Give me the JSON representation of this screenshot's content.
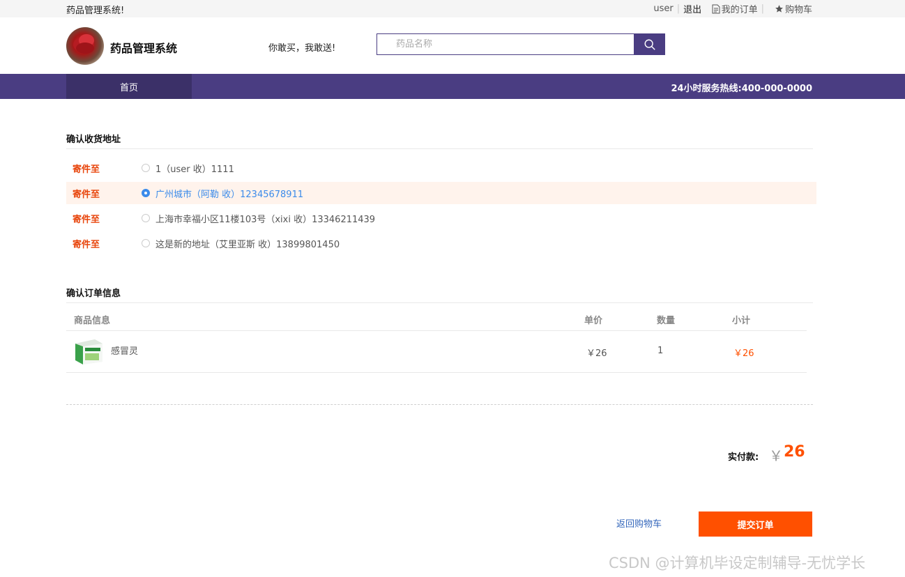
{
  "topbar": {
    "site_name": "药品管理系统!",
    "username": "user",
    "logout": "退出",
    "orders": "我的订单",
    "cart": "购物车",
    "orders_icon": "document-icon",
    "cart_icon": "star-icon"
  },
  "header": {
    "title": "药品管理系统",
    "slogan": "你敢买，我敢送!",
    "search_placeholder": "药品名称",
    "search_icon": "search-icon"
  },
  "nav": {
    "home": "首页",
    "hotline": "24小时服务热线:400-000-0000"
  },
  "address_section": {
    "title": "确认收货地址",
    "tag": "寄件至",
    "addresses": [
      {
        "text": "1（user 收）1111",
        "selected": false
      },
      {
        "text": "广州城市（阿勒 收）12345678911",
        "selected": true
      },
      {
        "text": "上海市幸福小区11楼103号（xixi 收）13346211439",
        "selected": false
      },
      {
        "text": "这是新的地址（艾里亚斯 收）13899801450",
        "selected": false
      }
    ]
  },
  "order_section": {
    "title": "确认订单信息",
    "headers": {
      "product": "商品信息",
      "price": "单价",
      "qty": "数量",
      "subtotal": "小计"
    },
    "items": [
      {
        "name": "感冒灵",
        "price": "￥26",
        "qty": "1",
        "subtotal": "￥26"
      }
    ]
  },
  "total": {
    "label": "实付款:",
    "currency": "￥",
    "value": "26"
  },
  "actions": {
    "back": "返回购物车",
    "submit": "提交订单"
  },
  "watermark": "CSDN @计算机毕设定制辅导-无忧学长",
  "colors": {
    "brand": "#4a3d82",
    "accent": "#ff5000",
    "selected": "#3b8bea"
  }
}
